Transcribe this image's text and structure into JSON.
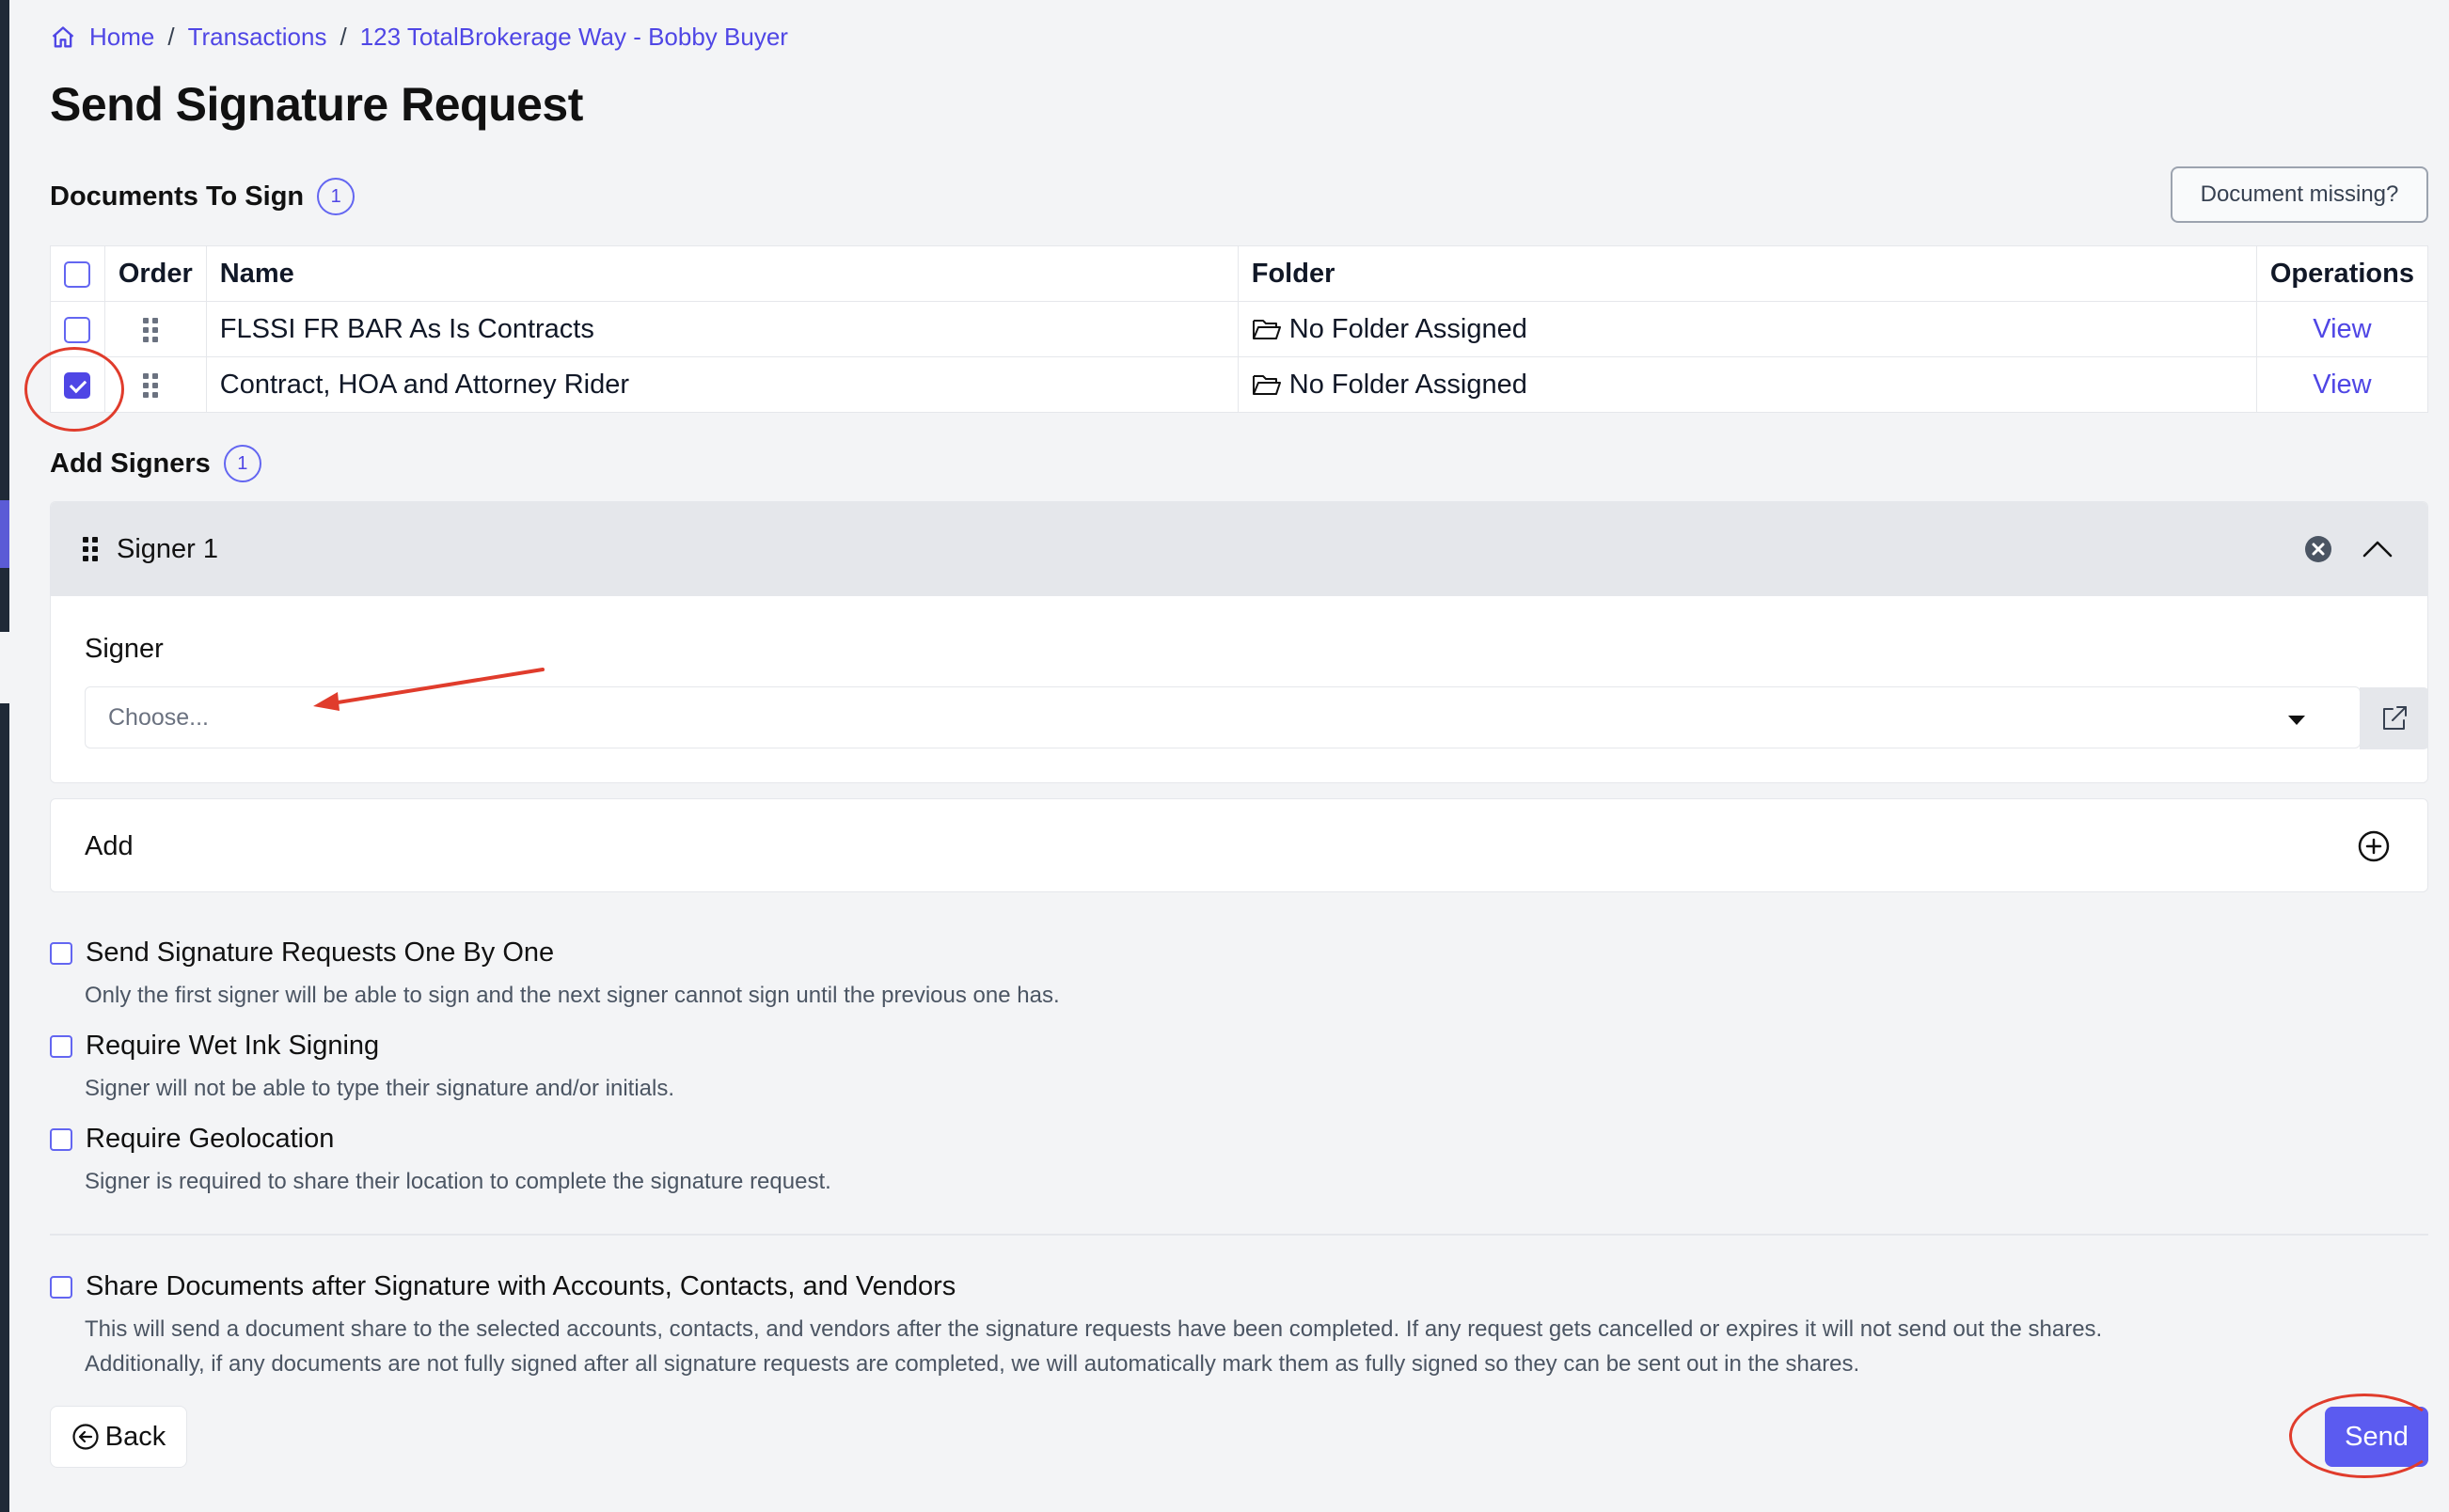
{
  "breadcrumb": {
    "home": "Home",
    "transactions": "Transactions",
    "current": "123 TotalBrokerage Way - Bobby Buyer",
    "separator": "/"
  },
  "page_title": "Send Signature Request",
  "documents": {
    "heading": "Documents To Sign",
    "count": "1",
    "missing_button": "Document missing?",
    "columns": {
      "order": "Order",
      "name": "Name",
      "folder": "Folder",
      "operations": "Operations"
    },
    "rows": [
      {
        "name": "FLSSI FR BAR As Is Contracts",
        "folder": "No Folder Assigned",
        "operation": "View",
        "checked": false
      },
      {
        "name": "Contract, HOA and Attorney Rider",
        "folder": "No Folder Assigned",
        "operation": "View",
        "checked": true
      }
    ]
  },
  "signers": {
    "heading": "Add Signers",
    "count": "1",
    "panel_title": "Signer 1",
    "field_label": "Signer",
    "select_placeholder": "Choose...",
    "add_label": "Add"
  },
  "options": [
    {
      "label": "Send Signature Requests One By One",
      "description": "Only the first signer will be able to sign and the next signer cannot sign until the previous one has.",
      "checked": false
    },
    {
      "label": "Require Wet Ink Signing",
      "description": "Signer will not be able to type their signature and/or initials.",
      "checked": false
    },
    {
      "label": "Require Geolocation",
      "description": "Signer is required to share their location to complete the signature request.",
      "checked": false
    }
  ],
  "share": {
    "label": "Share Documents after Signature with Accounts, Contacts, and Vendors",
    "description_line1": "This will send a document share to the selected accounts, contacts, and vendors after the signature requests have been completed. If any request gets cancelled or expires it will not send out the shares.",
    "description_line2": "Additionally, if any documents are not fully signed after all signature requests are completed, we will automatically mark them as fully signed so they can be sent out in the shares.",
    "checked": false
  },
  "footer": {
    "back_label": "Back",
    "send_label": "Send"
  },
  "colors": {
    "accent": "#4f46e5",
    "send_button": "#5b5bf0",
    "annotation": "#e03c2c",
    "background": "#f3f4f6"
  },
  "icons": [
    "home-icon",
    "drag-handle-icon",
    "folder-open-icon",
    "remove-circle-icon",
    "chevron-up-icon",
    "caret-down-icon",
    "external-link-icon",
    "plus-circle-icon",
    "arrow-left-circle-icon"
  ]
}
